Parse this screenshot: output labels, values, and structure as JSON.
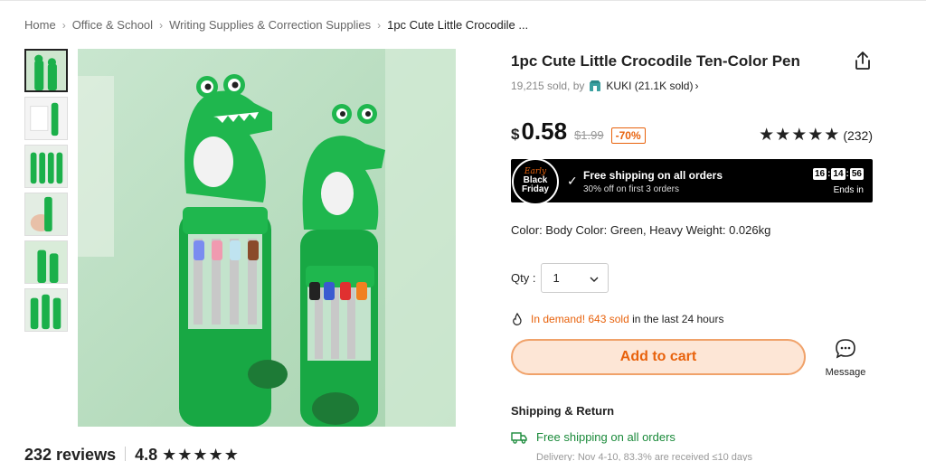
{
  "breadcrumb": {
    "items": [
      "Home",
      "Office & School",
      "Writing Supplies & Correction Supplies",
      "1pc Cute Little Crocodile ..."
    ]
  },
  "product": {
    "title": "1pc Cute Little Crocodile Ten-Color Pen",
    "sold_count": "19,215 sold, by",
    "store_name": "KUKI (21.1K sold)",
    "currency": "$",
    "price": "0.58",
    "original_price": "$1.99",
    "discount": "-70%",
    "rating_stars": "★★★★★",
    "rating_count": "(232)",
    "color_line": "Color: Body Color: Green, Heavy Weight: 0.026kg",
    "qty_label": "Qty :",
    "qty_value": "1"
  },
  "promo": {
    "badge_line1": "Early",
    "badge_line2": "Black",
    "badge_line3": "Friday",
    "title": "Free shipping on all orders",
    "subtitle": "30% off on first 3 orders",
    "timer": [
      "16",
      "14",
      "56"
    ],
    "ends_label": "Ends in"
  },
  "demand": {
    "hot_text": "In demand! 643 sold",
    "rest_text": " in the last 24 hours"
  },
  "actions": {
    "add_to_cart": "Add to cart",
    "message": "Message"
  },
  "shipping": {
    "heading": "Shipping & Return",
    "free_shipping": "Free shipping on all orders",
    "delivery": "Delivery: Nov 4-10, 83.3% are received ≤10 days"
  },
  "reviews": {
    "count_label": "232 reviews",
    "score": "4.8",
    "stars": "★★★★★"
  },
  "colors": {
    "accent": "#e8620c",
    "ship_green": "#1a8a3a",
    "product_green": "#1bb04a"
  },
  "icons": [
    "share-icon",
    "store-icon",
    "flame-icon",
    "chat-icon",
    "truck-icon",
    "check-icon"
  ]
}
